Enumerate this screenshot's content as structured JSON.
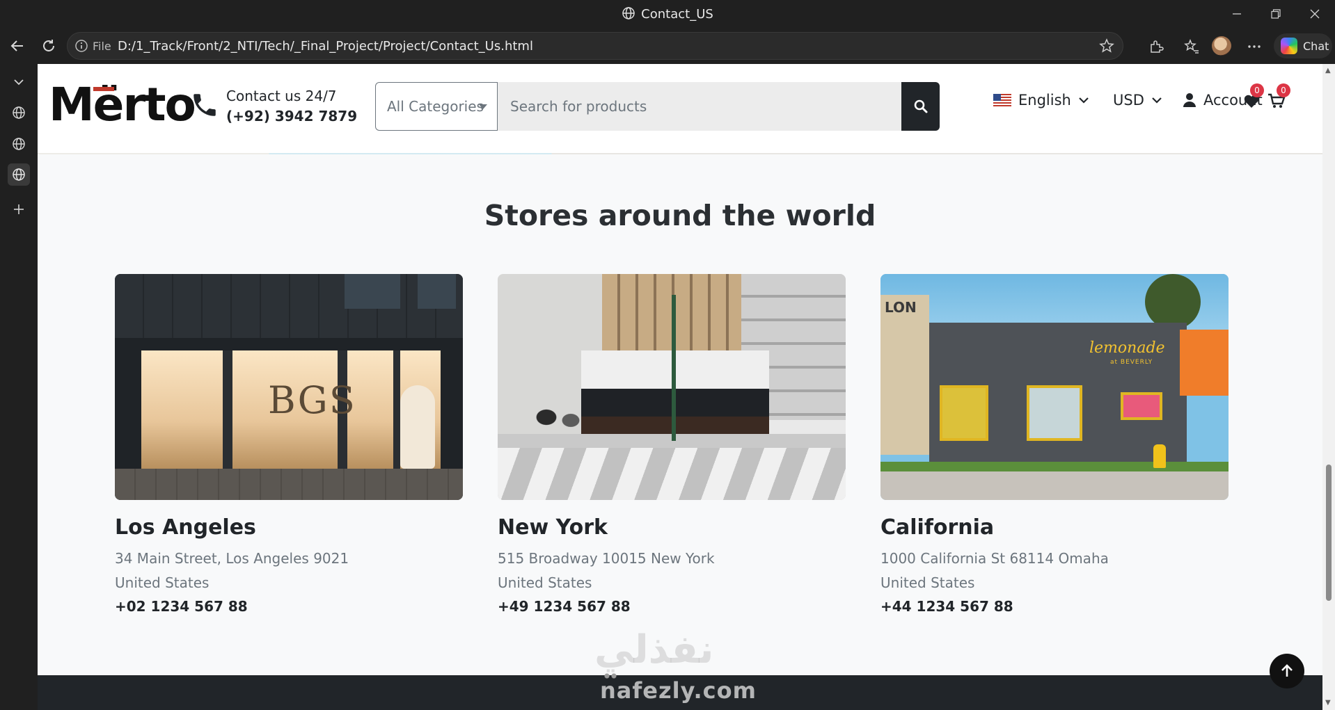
{
  "browser": {
    "tab_title": "Contact_US",
    "url_scheme_label": "File",
    "url": "D:/1_Track/Front/2_NTI/Tech/_Final_Project/Project/Contact_Us.html",
    "chat_label": "Chat"
  },
  "header": {
    "logo_text": "Mërto",
    "contact_label": "Contact us 24/7",
    "contact_phone": "(+92) 3942 7879",
    "category_select": "All Categories",
    "search_placeholder": "Search for products",
    "language": "English",
    "currency": "USD",
    "account_label": "Account",
    "wishlist_count": "0",
    "cart_count": "0"
  },
  "stores": {
    "title": "Stores around the world",
    "items": [
      {
        "city": "Los Angeles",
        "address": "34 Main Street, Los Angeles 9021",
        "country": "United States",
        "phone": "+02 1234 567 88"
      },
      {
        "city": "New York",
        "address": "515 Broadway 10015 New York",
        "country": "United States",
        "phone": "+49 1234 567 88"
      },
      {
        "city": "California",
        "address": "1000 California St 68114 Omaha",
        "country": "United States",
        "phone": "+44 1234 567 88"
      }
    ],
    "image_text": {
      "la_sign": "BGS",
      "ca_building": "LON",
      "ca_sign": "lemonade",
      "ca_sign_sub": "at BEVERLY"
    }
  },
  "watermark": {
    "arabic": "نفذلي",
    "latin": "nafezly.com"
  },
  "colors": {
    "badge": "#dc3545",
    "dark": "#212529",
    "page_bg": "#f8f9fa"
  }
}
